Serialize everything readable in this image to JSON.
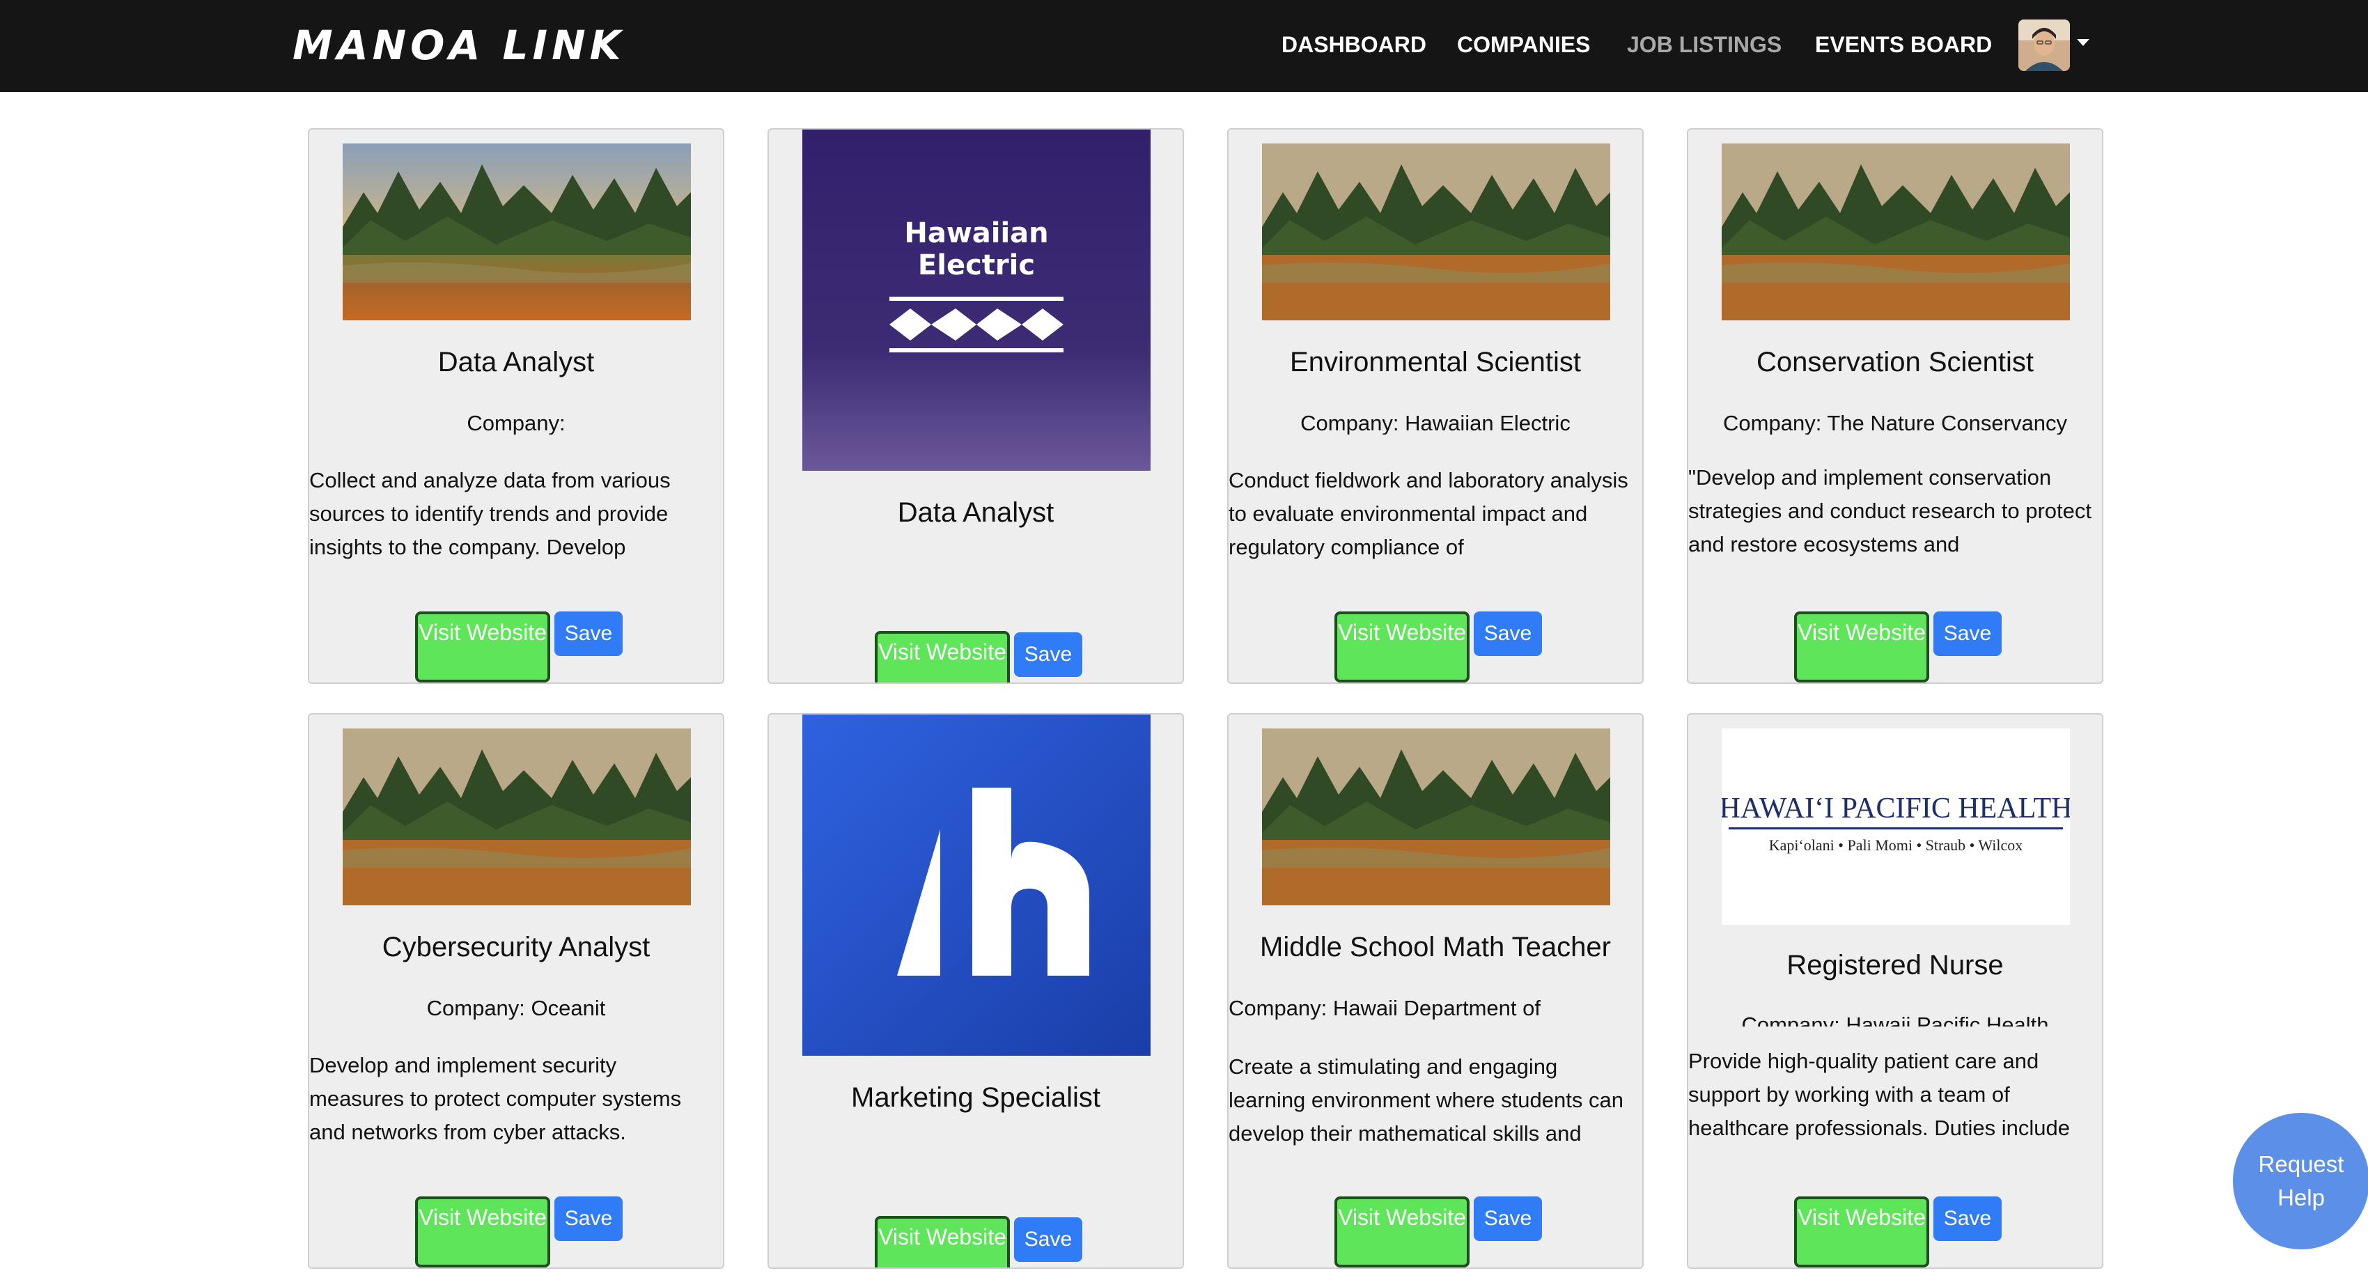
{
  "app": {
    "logo_text": "MANOA LINK",
    "nav": [
      "DASHBOARD",
      "COMPANIES",
      "JOB LISTINGS",
      "EVENTS BOARD"
    ],
    "avatar_icon": "user-avatar-photo"
  },
  "cards": [
    {
      "title": "Data Analyst",
      "company": "Company:",
      "description": "Collect and analyze data from various sources to identify trends and provide insights to the company. Develop",
      "visit_label": "Visit Website",
      "save_label": "Save",
      "image": "landscape"
    },
    {
      "title": "Data Analyst",
      "company": "",
      "description": "",
      "visit_label": "Visit Website",
      "save_label": "Save",
      "image": "hawaiian-electric-logo",
      "logo_lines": [
        "Hawaiian",
        "Electric"
      ]
    },
    {
      "title": "Environmental Scientist",
      "company": "Company: Hawaiian Electric",
      "description": "Conduct fieldwork and laboratory analysis to evaluate environmental impact and regulatory compliance of",
      "visit_label": "Visit Website",
      "save_label": "Save",
      "image": "landscape"
    },
    {
      "title": "Conservation Scientist",
      "company": "Company: The Nature Conservancy",
      "description": "\"Develop and implement conservation strategies and conduct research to protect and restore ecosystems and",
      "visit_label": "Visit Website",
      "save_label": "Save",
      "image": "landscape"
    },
    {
      "title": "Cybersecurity Analyst",
      "company": "Company: Oceanit",
      "description": "Develop and implement security measures to protect computer systems and networks from cyber attacks.",
      "visit_label": "Visit Website",
      "save_label": "Save",
      "image": "landscape"
    },
    {
      "title": "Marketing Specialist",
      "company": "",
      "description": "",
      "visit_label": "Visit Website",
      "save_label": "Save",
      "image": "h-brand-logo"
    },
    {
      "title": "Middle School Math Teacher",
      "company": "Company: Hawaii Department of",
      "description": "Create a stimulating and engaging learning environment where students can develop their mathematical skills and",
      "visit_label": "Visit Website",
      "save_label": "Save",
      "image": "landscape"
    },
    {
      "title": "Registered Nurse",
      "company": "Company: Hawaii Pacific Health",
      "description": "Provide high-quality patient care and support by working with a team of healthcare professionals. Duties include",
      "visit_label": "Visit Website",
      "save_label": "Save",
      "image": "hawaii-pacific-health-logo",
      "logo_lines": [
        "HAWAIʻI PACIFIC HEALTH",
        "Kapiʻolani • Pali Momi • Straub • Wilcox"
      ]
    }
  ],
  "help": {
    "label": "Request Help"
  },
  "colors": {
    "navbar": "#151515",
    "visit": "#5ee55a",
    "save": "#2f7cf6",
    "help": "#5c8fe8",
    "card_bg": "#eeeeee"
  }
}
